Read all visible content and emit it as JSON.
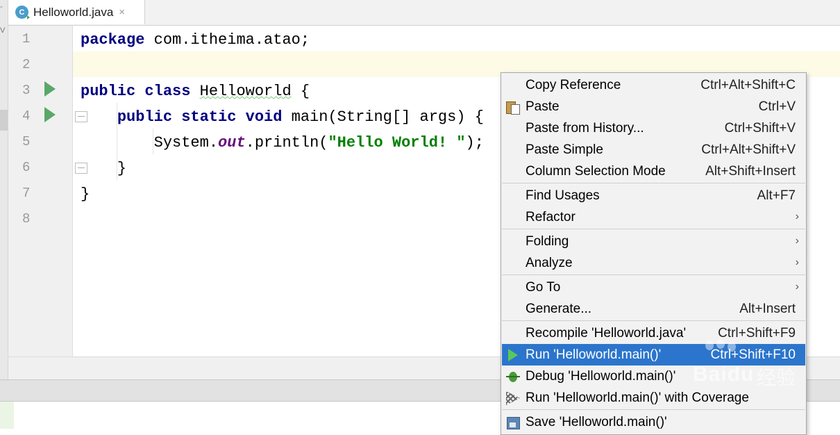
{
  "tab": {
    "title": "Helloworld.java",
    "close": "×",
    "icon": "C"
  },
  "left_strip": {
    "marks": [
      "-",
      "V"
    ]
  },
  "editor": {
    "line_numbers": [
      "1",
      "2",
      "3",
      "4",
      "5",
      "6",
      "7",
      "8"
    ],
    "lines": {
      "l1": {
        "kw": "package",
        "rest": " com.itheima.atao;"
      },
      "l3": {
        "kw": "public class",
        "sp": " ",
        "name": "Helloworld",
        "rest": " {"
      },
      "l4": {
        "indent": "    ",
        "kw": "public static void",
        "rest": " main(String[] args) {"
      },
      "l5": {
        "indent": "        ",
        "pre": "System.",
        "field": "out",
        "mid": ".println(",
        "str": "\"Hello World! \"",
        "post": ");"
      },
      "l6": {
        "text": "    }"
      },
      "l7": {
        "text": "}"
      }
    }
  },
  "context_menu": {
    "copy_reference": {
      "label": "Copy Reference",
      "shortcut": "Ctrl+Alt+Shift+C"
    },
    "paste": {
      "label": "Paste",
      "shortcut": "Ctrl+V"
    },
    "paste_history": {
      "label": "Paste from History...",
      "shortcut": "Ctrl+Shift+V"
    },
    "paste_simple": {
      "label": "Paste Simple",
      "shortcut": "Ctrl+Alt+Shift+V"
    },
    "column_selection": {
      "label": "Column Selection Mode",
      "shortcut": "Alt+Shift+Insert"
    },
    "find_usages": {
      "label": "Find Usages",
      "shortcut": "Alt+F7"
    },
    "refactor": {
      "label": "Refactor"
    },
    "folding": {
      "label": "Folding"
    },
    "analyze": {
      "label": "Analyze"
    },
    "go_to": {
      "label": "Go To"
    },
    "generate": {
      "label": "Generate...",
      "shortcut": "Alt+Insert"
    },
    "recompile": {
      "label": "Recompile 'Helloworld.java'",
      "shortcut": "Ctrl+Shift+F9"
    },
    "run": {
      "label": "Run 'Helloworld.main()'",
      "shortcut": "Ctrl+Shift+F10"
    },
    "debug": {
      "label": "Debug 'Helloworld.main()'"
    },
    "run_coverage": {
      "label": "Run 'Helloworld.main()' with Coverage"
    },
    "save": {
      "label": "Save 'Helloworld.main()'"
    },
    "submenu_arrow": "›"
  },
  "watermark": {
    "brand": "Bai",
    "brand2": "du",
    "cn": "经验"
  },
  "colors": {
    "keyword": "#000080",
    "field": "#660e7a",
    "string": "#008000",
    "run_green": "#59a869",
    "menu_highlight": "#2c75cc",
    "current_line": "#fdfbe6"
  }
}
